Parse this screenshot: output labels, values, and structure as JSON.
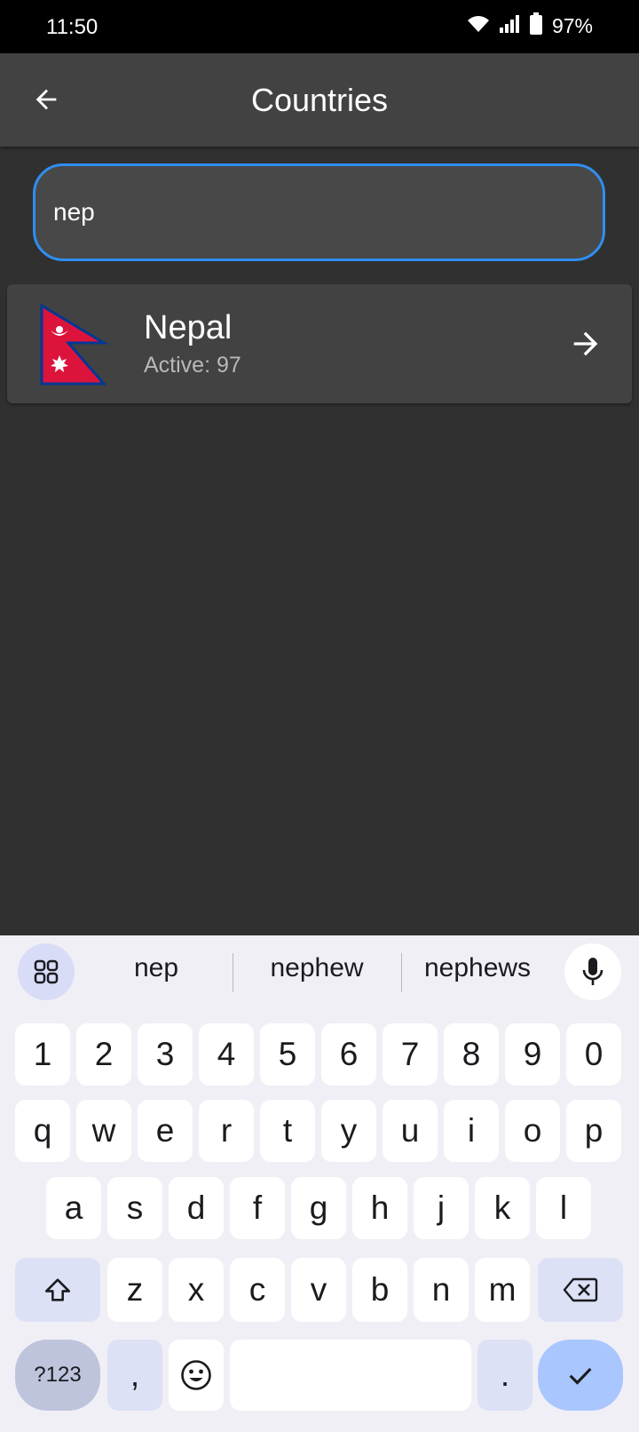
{
  "status": {
    "time": "11:50",
    "battery": "97%"
  },
  "app_bar": {
    "title": "Countries"
  },
  "search": {
    "value": "nep",
    "placeholder": ""
  },
  "results": [
    {
      "name": "Nepal",
      "active_text": "Active: 97"
    }
  ],
  "keyboard": {
    "suggestions": [
      "nep",
      "nephew",
      "nephews"
    ],
    "row_numbers": [
      "1",
      "2",
      "3",
      "4",
      "5",
      "6",
      "7",
      "8",
      "9",
      "0"
    ],
    "row1": [
      "q",
      "w",
      "e",
      "r",
      "t",
      "y",
      "u",
      "i",
      "o",
      "p"
    ],
    "row2": [
      "a",
      "s",
      "d",
      "f",
      "g",
      "h",
      "j",
      "k",
      "l"
    ],
    "row3": [
      "z",
      "x",
      "c",
      "v",
      "b",
      "n",
      "m"
    ],
    "symbols_label": "?123",
    "comma": ",",
    "period": "."
  },
  "colors": {
    "accent": "#2f8ef0",
    "flag_red": "#dc143c",
    "flag_blue": "#003893"
  }
}
